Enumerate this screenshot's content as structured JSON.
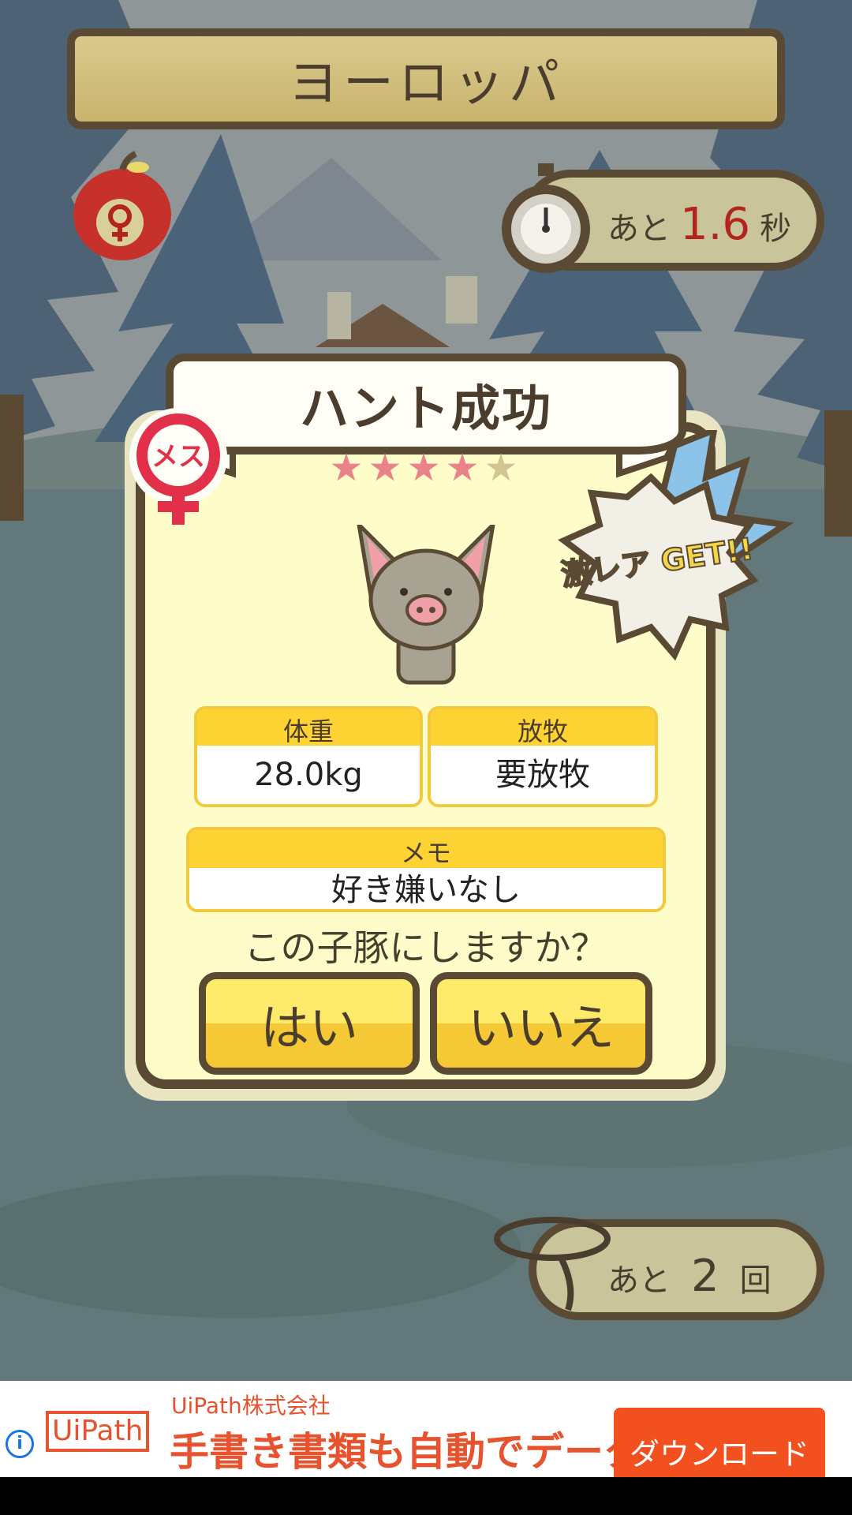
{
  "header": {
    "region": "ヨーロッパ"
  },
  "timer": {
    "prefix": "あと",
    "value": "1.6",
    "unit": "秒"
  },
  "lasso": {
    "prefix": "あと",
    "value": "2",
    "unit": "回"
  },
  "result": {
    "title": "ハント成功",
    "stars_total": 5,
    "stars_filled": 4,
    "gender_badge": "メス",
    "rare_badge": "激レア GET!!",
    "stats": {
      "weight_label": "体重",
      "weight_value": "28.0kg",
      "graze_label": "放牧",
      "graze_value": "要放牧",
      "memo_label": "メモ",
      "memo_value": "好き嫌いなし"
    },
    "question": "この子豚にしますか？",
    "yes_label": "はい",
    "no_label": "いいえ"
  },
  "ad": {
    "company": "UiPath株式会社",
    "copy": "手書き書類も自動でデータ化",
    "logo_text": "UiPath",
    "cta": "ダウンロード"
  },
  "colors": {
    "accent_red": "#b2241d",
    "board_brown": "#5a4a34",
    "button_yellow": "#f4c935",
    "ad_orange": "#f2501e"
  }
}
